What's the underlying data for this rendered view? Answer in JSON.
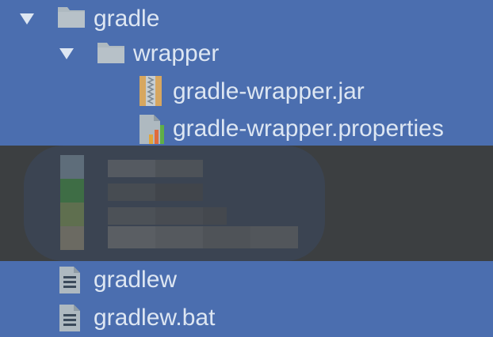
{
  "tree": {
    "items": [
      {
        "label": "gradle",
        "icon": "folder-icon",
        "expanded": true
      },
      {
        "label": "wrapper",
        "icon": "folder-icon",
        "expanded": true
      },
      {
        "label": "gradle-wrapper.jar",
        "icon": "jar-archive-icon"
      },
      {
        "label": "gradle-wrapper.properties",
        "icon": "properties-file-icon"
      },
      {
        "label": "gradlew",
        "icon": "text-file-icon"
      },
      {
        "label": "gradlew.bat",
        "icon": "text-file-icon"
      }
    ]
  },
  "colors": {
    "selection": "#4b6eaf",
    "text": "#dde6f2",
    "folder": "#aeb9c0",
    "obscured_background": "#3c3f41"
  }
}
